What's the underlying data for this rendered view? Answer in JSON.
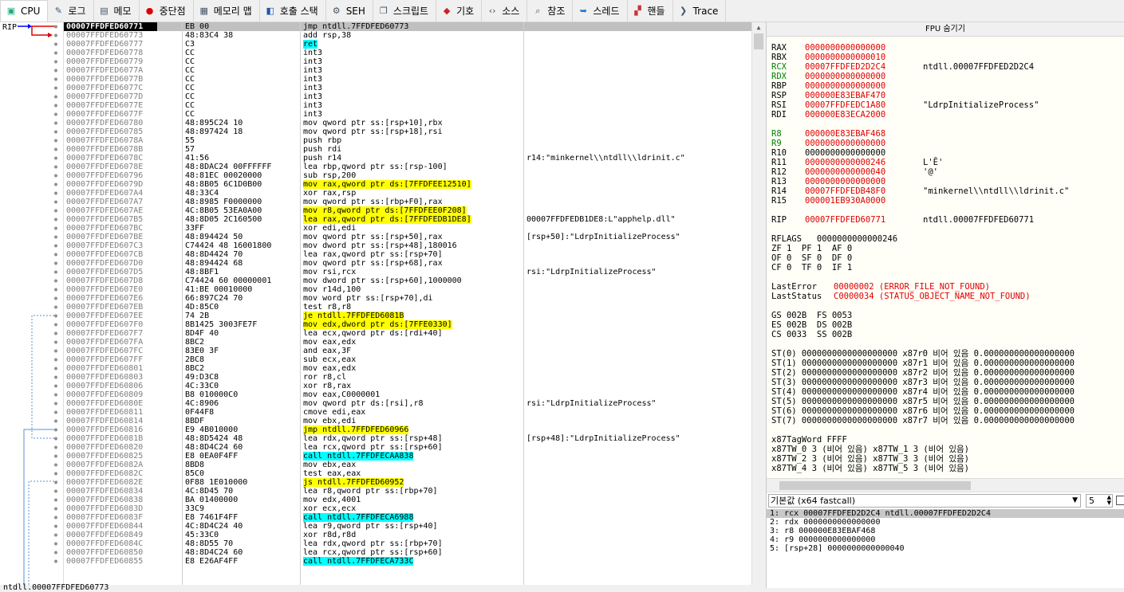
{
  "tabs": [
    {
      "id": "cpu",
      "label": "CPU",
      "icon": "cpu-icon",
      "active": true
    },
    {
      "id": "log",
      "label": "로그",
      "icon": "log-icon"
    },
    {
      "id": "notes",
      "label": "메모",
      "icon": "notes-icon"
    },
    {
      "id": "breakpoints",
      "label": "중단점",
      "icon": "breakpoint-icon"
    },
    {
      "id": "memmap",
      "label": "메모리 맵",
      "icon": "memory-map-icon"
    },
    {
      "id": "callstack",
      "label": "호출 스택",
      "icon": "call-stack-icon"
    },
    {
      "id": "seh",
      "label": "SEH",
      "icon": "seh-icon"
    },
    {
      "id": "script",
      "label": "스크립트",
      "icon": "script-icon"
    },
    {
      "id": "symbols",
      "label": "기호",
      "icon": "symbols-icon"
    },
    {
      "id": "source",
      "label": "소스",
      "icon": "source-icon"
    },
    {
      "id": "refs",
      "label": "참조",
      "icon": "references-icon"
    },
    {
      "id": "threads",
      "label": "스레드",
      "icon": "threads-icon"
    },
    {
      "id": "handles",
      "label": "핸들",
      "icon": "handles-icon"
    },
    {
      "id": "trace",
      "label": "Trace",
      "icon": "trace-icon"
    }
  ],
  "gutter": {
    "rip_label": "RIP"
  },
  "disasm": [
    {
      "addr": "00007FFDFED60771",
      "bytes": "EB 00",
      "ins": "jmp ntdll.7FFDFED60773",
      "cmt": "",
      "sel": true
    },
    {
      "addr": "00007FFDFED60773",
      "bytes": "48:83C4 38",
      "ins": "add rsp,38",
      "cmt": ""
    },
    {
      "addr": "00007FFDFED60777",
      "bytes": "C3",
      "ins": "ret",
      "cmt": "",
      "hl": "c"
    },
    {
      "addr": "00007FFDFED60778",
      "bytes": "CC",
      "ins": "int3",
      "cmt": ""
    },
    {
      "addr": "00007FFDFED60779",
      "bytes": "CC",
      "ins": "int3",
      "cmt": ""
    },
    {
      "addr": "00007FFDFED6077A",
      "bytes": "CC",
      "ins": "int3",
      "cmt": ""
    },
    {
      "addr": "00007FFDFED6077B",
      "bytes": "CC",
      "ins": "int3",
      "cmt": ""
    },
    {
      "addr": "00007FFDFED6077C",
      "bytes": "CC",
      "ins": "int3",
      "cmt": ""
    },
    {
      "addr": "00007FFDFED6077D",
      "bytes": "CC",
      "ins": "int3",
      "cmt": ""
    },
    {
      "addr": "00007FFDFED6077E",
      "bytes": "CC",
      "ins": "int3",
      "cmt": ""
    },
    {
      "addr": "00007FFDFED6077F",
      "bytes": "CC",
      "ins": "int3",
      "cmt": ""
    },
    {
      "addr": "00007FFDFED60780",
      "bytes": "48:895C24 10",
      "ins": "mov qword ptr ss:[rsp+10],rbx",
      "cmt": ""
    },
    {
      "addr": "00007FFDFED60785",
      "bytes": "48:897424 18",
      "ins": "mov qword ptr ss:[rsp+18],rsi",
      "cmt": ""
    },
    {
      "addr": "00007FFDFED6078A",
      "bytes": "55",
      "ins": "push rbp",
      "cmt": ""
    },
    {
      "addr": "00007FFDFED6078B",
      "bytes": "57",
      "ins": "push rdi",
      "cmt": ""
    },
    {
      "addr": "00007FFDFED6078C",
      "bytes": "41:56",
      "ins": "push r14",
      "cmt": "r14:\"minkernel\\\\ntdll\\\\ldrinit.c\""
    },
    {
      "addr": "00007FFDFED6078E",
      "bytes": "48:8DAC24 00FFFFFF",
      "ins": "lea rbp,qword ptr ss:[rsp-100]",
      "cmt": ""
    },
    {
      "addr": "00007FFDFED60796",
      "bytes": "48:81EC 00020000",
      "ins": "sub rsp,200",
      "cmt": ""
    },
    {
      "addr": "00007FFDFED6079D",
      "bytes": "48:8B05 6C1D0B00",
      "ins": "mov rax,qword ptr ds:[7FFDFEE12510]",
      "cmt": "",
      "hl": "y"
    },
    {
      "addr": "00007FFDFED607A4",
      "bytes": "48:33C4",
      "ins": "xor rax,rsp",
      "cmt": ""
    },
    {
      "addr": "00007FFDFED607A7",
      "bytes": "48:8985 F0000000",
      "ins": "mov qword ptr ss:[rbp+F0],rax",
      "cmt": ""
    },
    {
      "addr": "00007FFDFED607AE",
      "bytes": "4C:8B05 53EA0A00",
      "ins": "mov r8,qword ptr ds:[7FFDFEE0F208]",
      "cmt": "",
      "hl": "y"
    },
    {
      "addr": "00007FFDFED607B5",
      "bytes": "48:8D05 2C160500",
      "ins": "lea rax,qword ptr ds:[7FFDFEDB1DE8]",
      "cmt": "00007FFDFEDB1DE8:L\"apphelp.dll\"",
      "hl": "y"
    },
    {
      "addr": "00007FFDFED607BC",
      "bytes": "33FF",
      "ins": "xor edi,edi",
      "cmt": ""
    },
    {
      "addr": "00007FFDFED607BE",
      "bytes": "48:894424 50",
      "ins": "mov qword ptr ss:[rsp+50],rax",
      "cmt": "[rsp+50]:\"LdrpInitializeProcess\""
    },
    {
      "addr": "00007FFDFED607C3",
      "bytes": "C74424 48 16001800",
      "ins": "mov dword ptr ss:[rsp+48],180016",
      "cmt": ""
    },
    {
      "addr": "00007FFDFED607CB",
      "bytes": "48:8D4424 70",
      "ins": "lea rax,qword ptr ss:[rsp+70]",
      "cmt": ""
    },
    {
      "addr": "00007FFDFED607D0",
      "bytes": "48:894424 68",
      "ins": "mov qword ptr ss:[rsp+68],rax",
      "cmt": ""
    },
    {
      "addr": "00007FFDFED607D5",
      "bytes": "48:8BF1",
      "ins": "mov rsi,rcx",
      "cmt": "rsi:\"LdrpInitializeProcess\""
    },
    {
      "addr": "00007FFDFED607D8",
      "bytes": "C74424 60 00000001",
      "ins": "mov dword ptr ss:[rsp+60],1000000",
      "cmt": ""
    },
    {
      "addr": "00007FFDFED607E0",
      "bytes": "41:BE 00010000",
      "ins": "mov r14d,100",
      "cmt": ""
    },
    {
      "addr": "00007FFDFED607E6",
      "bytes": "66:897C24 70",
      "ins": "mov word ptr ss:[rsp+70],di",
      "cmt": ""
    },
    {
      "addr": "00007FFDFED607EB",
      "bytes": "4D:85C0",
      "ins": "test r8,r8",
      "cmt": ""
    },
    {
      "addr": "00007FFDFED607EE",
      "bytes": "74 2B",
      "ins": "je ntdll.7FFDFED6081B",
      "cmt": "",
      "hl": "y"
    },
    {
      "addr": "00007FFDFED607F0",
      "bytes": "8B1425 3003FE7F",
      "ins": "mov edx,dword ptr ds:[7FFE0330]",
      "cmt": "",
      "hl": "y"
    },
    {
      "addr": "00007FFDFED607F7",
      "bytes": "8D4F 40",
      "ins": "lea ecx,qword ptr ds:[rdi+40]",
      "cmt": ""
    },
    {
      "addr": "00007FFDFED607FA",
      "bytes": "8BC2",
      "ins": "mov eax,edx",
      "cmt": ""
    },
    {
      "addr": "00007FFDFED607FC",
      "bytes": "83E0 3F",
      "ins": "and eax,3F",
      "cmt": ""
    },
    {
      "addr": "00007FFDFED607FF",
      "bytes": "2BC8",
      "ins": "sub ecx,eax",
      "cmt": ""
    },
    {
      "addr": "00007FFDFED60801",
      "bytes": "8BC2",
      "ins": "mov eax,edx",
      "cmt": ""
    },
    {
      "addr": "00007FFDFED60803",
      "bytes": "49:D3C8",
      "ins": "ror r8,cl",
      "cmt": ""
    },
    {
      "addr": "00007FFDFED60806",
      "bytes": "4C:33C0",
      "ins": "xor r8,rax",
      "cmt": ""
    },
    {
      "addr": "00007FFDFED60809",
      "bytes": "B8 010000C0",
      "ins": "mov eax,C0000001",
      "cmt": ""
    },
    {
      "addr": "00007FFDFED6080E",
      "bytes": "4C:8906",
      "ins": "mov qword ptr ds:[rsi],r8",
      "cmt": "rsi:\"LdrpInitializeProcess\""
    },
    {
      "addr": "00007FFDFED60811",
      "bytes": "0F44F8",
      "ins": "cmove edi,eax",
      "cmt": ""
    },
    {
      "addr": "00007FFDFED60814",
      "bytes": "8BDF",
      "ins": "mov ebx,edi",
      "cmt": ""
    },
    {
      "addr": "00007FFDFED60816",
      "bytes": "E9 4B010000",
      "ins": "jmp ntdll.7FFDFED60966",
      "cmt": "",
      "hl": "y"
    },
    {
      "addr": "00007FFDFED6081B",
      "bytes": "48:8D5424 48",
      "ins": "lea rdx,qword ptr ss:[rsp+48]",
      "cmt": "[rsp+48]:\"LdrpInitializeProcess\""
    },
    {
      "addr": "00007FFDFED60820",
      "bytes": "48:8D4C24 60",
      "ins": "lea rcx,qword ptr ss:[rsp+60]",
      "cmt": ""
    },
    {
      "addr": "00007FFDFED60825",
      "bytes": "E8 0EA0F4FF",
      "ins": "call ntdll.7FFDFECAA838",
      "cmt": "",
      "hl": "c"
    },
    {
      "addr": "00007FFDFED6082A",
      "bytes": "8BD8",
      "ins": "mov ebx,eax",
      "cmt": ""
    },
    {
      "addr": "00007FFDFED6082C",
      "bytes": "85C0",
      "ins": "test eax,eax",
      "cmt": ""
    },
    {
      "addr": "00007FFDFED6082E",
      "bytes": "0F88 1E010000",
      "ins": "js ntdll.7FFDFED60952",
      "cmt": "",
      "hl": "y"
    },
    {
      "addr": "00007FFDFED60834",
      "bytes": "4C:8D45 70",
      "ins": "lea r8,qword ptr ss:[rbp+70]",
      "cmt": ""
    },
    {
      "addr": "00007FFDFED60838",
      "bytes": "BA 01400000",
      "ins": "mov edx,4001",
      "cmt": ""
    },
    {
      "addr": "00007FFDFED6083D",
      "bytes": "33C9",
      "ins": "xor ecx,ecx",
      "cmt": ""
    },
    {
      "addr": "00007FFDFED6083F",
      "bytes": "E8 7461F4FF",
      "ins": "call ntdll.7FFDFECA6988",
      "cmt": "",
      "hl": "c"
    },
    {
      "addr": "00007FFDFED60844",
      "bytes": "4C:8D4C24 40",
      "ins": "lea r9,qword ptr ss:[rsp+40]",
      "cmt": ""
    },
    {
      "addr": "00007FFDFED60849",
      "bytes": "45:33C0",
      "ins": "xor r8d,r8d",
      "cmt": ""
    },
    {
      "addr": "00007FFDFED6084C",
      "bytes": "48:8D55 70",
      "ins": "lea rdx,qword ptr ss:[rbp+70]",
      "cmt": ""
    },
    {
      "addr": "00007FFDFED60850",
      "bytes": "48:8D4C24 60",
      "ins": "lea rcx,qword ptr ss:[rsp+60]",
      "cmt": ""
    },
    {
      "addr": "00007FFDFED60855",
      "bytes": "E8 E26AF4FF",
      "ins": "call ntdll.7FFDFECA733C",
      "cmt": "",
      "hl": "c"
    }
  ],
  "status_line": "ntdll.00007FFDFED60773",
  "fpu": {
    "header": "FPU 숨기기",
    "regs": [
      {
        "name": "RAX",
        "val": "0000000000000000",
        "info": ""
      },
      {
        "name": "RBX",
        "val": "0000000000000010",
        "info": ""
      },
      {
        "name": "RCX",
        "val": "00007FFDFED2D2C4",
        "info": "ntdll.00007FFDFED2D2C4",
        "green": true
      },
      {
        "name": "RDX",
        "val": "0000000000000000",
        "info": "",
        "green": true
      },
      {
        "name": "RBP",
        "val": "0000000000000000",
        "info": ""
      },
      {
        "name": "RSP",
        "val": "000000E83EBAF470",
        "info": ""
      },
      {
        "name": "RSI",
        "val": "00007FFDFEDC1A80",
        "info": "\"LdrpInitializeProcess\""
      },
      {
        "name": "RDI",
        "val": "000000E83ECA2000",
        "info": ""
      }
    ],
    "regs2": [
      {
        "name": "R8",
        "val": "000000E83EBAF468",
        "info": "",
        "green": true
      },
      {
        "name": "R9",
        "val": "0000000000000000",
        "info": "",
        "green": true
      },
      {
        "name": "R10",
        "val": "0000000000000000",
        "info": "",
        "black": true
      },
      {
        "name": "R11",
        "val": "0000000000000246",
        "info": "L'Ȇ'"
      },
      {
        "name": "R12",
        "val": "0000000000000040",
        "info": "'@'"
      },
      {
        "name": "R13",
        "val": "0000000000000000",
        "info": ""
      },
      {
        "name": "R14",
        "val": "00007FFDFEDB48F0",
        "info": "\"minkernel\\\\ntdll\\\\ldrinit.c\""
      },
      {
        "name": "R15",
        "val": "000001EB930A0000",
        "info": ""
      }
    ],
    "rip": {
      "name": "RIP",
      "val": "00007FFDFED60771",
      "info": "ntdll.00007FFDFED60771"
    },
    "rflags": "RFLAGS   0000000000000246",
    "flags": [
      "ZF 1  PF 1  AF 0",
      "OF 0  SF 0  DF 0",
      "CF 0  TF 0  IF 1"
    ],
    "lasterror": {
      "label": "LastError",
      "val": "00000002 (ERROR_FILE_NOT_FOUND)"
    },
    "laststatus": {
      "label": "LastStatus",
      "val": "C0000034 (STATUS_OBJECT_NAME_NOT_FOUND)"
    },
    "segs": [
      "GS 002B  FS 0053",
      "ES 002B  DS 002B",
      "CS 0033  SS 002B"
    ],
    "st": [
      "ST(0) 0000000000000000000 x87r0 비어 있음 0.000000000000000000",
      "ST(1) 0000000000000000000 x87r1 비어 있음 0.000000000000000000",
      "ST(2) 0000000000000000000 x87r2 비어 있음 0.000000000000000000",
      "ST(3) 0000000000000000000 x87r3 비어 있음 0.000000000000000000",
      "ST(4) 0000000000000000000 x87r4 비어 있음 0.000000000000000000",
      "ST(5) 0000000000000000000 x87r5 비어 있음 0.000000000000000000",
      "ST(6) 0000000000000000000 x87r6 비어 있음 0.000000000000000000",
      "ST(7) 0000000000000000000 x87r7 비어 있음 0.000000000000000000"
    ],
    "tag": [
      "x87TagWord FFFF",
      "x87TW_0 3 (비어 있음) x87TW_1 3 (비어 있음)",
      "x87TW_2 3 (비어 있음) x87TW_3 3 (비어 있음)",
      "x87TW_4 3 (비어 있음) x87TW_5 3 (비어 있음)"
    ]
  },
  "callconv": {
    "selected": "기본값 (x64 fastcall)",
    "count": "5"
  },
  "args": [
    "1: rcx 00007FFDFED2D2C4 ntdll.00007FFDFED2D2C4",
    "2: rdx 0000000000000000",
    "3: r8 000000E83EBAF468",
    "4: r9 0000000000000000",
    "5: [rsp+28] 0000000000000040"
  ],
  "colors": {
    "selection": "#000000",
    "highlight_yellow": "#ffff00",
    "highlight_cyan": "#00ffff",
    "reg_changed": "#e00000",
    "reg_args": "#008000"
  }
}
